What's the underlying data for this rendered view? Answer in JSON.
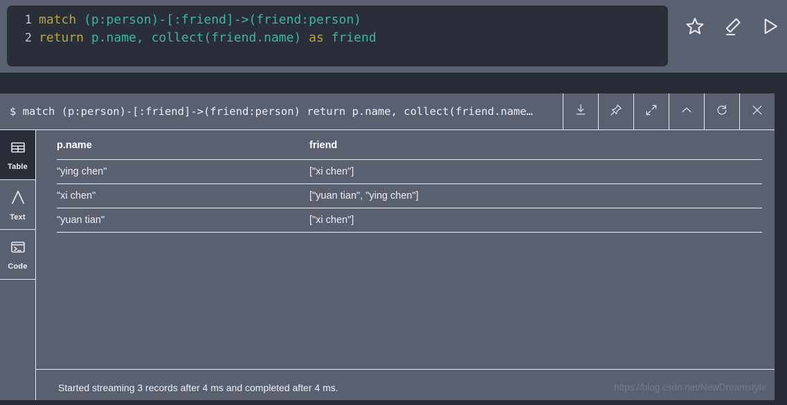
{
  "editor": {
    "lines": [
      {
        "number": "1",
        "tokens": [
          {
            "text": "match",
            "type": "keyword"
          },
          {
            "text": " (p:person)-[:friend]->(friend:person)",
            "type": "normal"
          }
        ]
      },
      {
        "number": "2",
        "tokens": [
          {
            "text": "return",
            "type": "keyword"
          },
          {
            "text": " p.name, collect(friend.name) ",
            "type": "normal"
          },
          {
            "text": "as",
            "type": "keyword"
          },
          {
            "text": " friend",
            "type": "normal"
          }
        ]
      }
    ],
    "line1_number": "1",
    "line1_kw": "match",
    "line1_rest": " (p:person)-[:friend]->(friend:person)",
    "line2_number": "2",
    "line2_kw": "return",
    "line2_mid": " p.name, collect(friend.name) ",
    "line2_kw2": "as",
    "line2_end": " friend",
    "icons": [
      {
        "name": "favorite-star-icon",
        "label": "Favorite"
      },
      {
        "name": "eraser-icon",
        "label": "Clear"
      },
      {
        "name": "run-play-icon",
        "label": "Run"
      }
    ]
  },
  "result": {
    "query_line": "$ match (p:person)-[:friend]->(friend:person) return p.name, collect(friend.name…",
    "header_icons": [
      {
        "name": "download-icon",
        "label": "Download"
      },
      {
        "name": "pin-icon",
        "label": "Pin"
      },
      {
        "name": "expand-icon",
        "label": "Fullscreen"
      },
      {
        "name": "collapse-chevron-up-icon",
        "label": "Collapse"
      },
      {
        "name": "refresh-icon",
        "label": "Rerun"
      },
      {
        "name": "close-icon",
        "label": "Close"
      }
    ],
    "view_tabs": [
      {
        "name": "tab-table",
        "label": "Table",
        "icon": "table-grid-icon",
        "active": true
      },
      {
        "name": "tab-text",
        "label": "Text",
        "icon": "letter-a-icon",
        "active": false
      },
      {
        "name": "tab-code",
        "label": "Code",
        "icon": "terminal-prompt-icon",
        "active": false
      }
    ],
    "table": {
      "columns": [
        "p.name",
        "friend"
      ],
      "rows": [
        [
          "\"ying chen\"",
          "[\"xi chen\"]"
        ],
        [
          "\"xi chen\"",
          "[\"yuan tian\", \"ying chen\"]"
        ],
        [
          "\"yuan tian\"",
          "[\"xi chen\"]"
        ]
      ]
    },
    "status": "Started streaming 3 records after 4 ms and completed after 4 ms.",
    "watermark": "https://blog.csdn.net/NewDreamstyle"
  },
  "colors": {
    "panel_bg": "#5b6070",
    "editor_bg": "#2a2e39",
    "page_bg": "#272b35",
    "keyword": "#b5a642",
    "code_text": "#3fb69b",
    "divider": "#e9eaee",
    "text": "#eceef3"
  }
}
